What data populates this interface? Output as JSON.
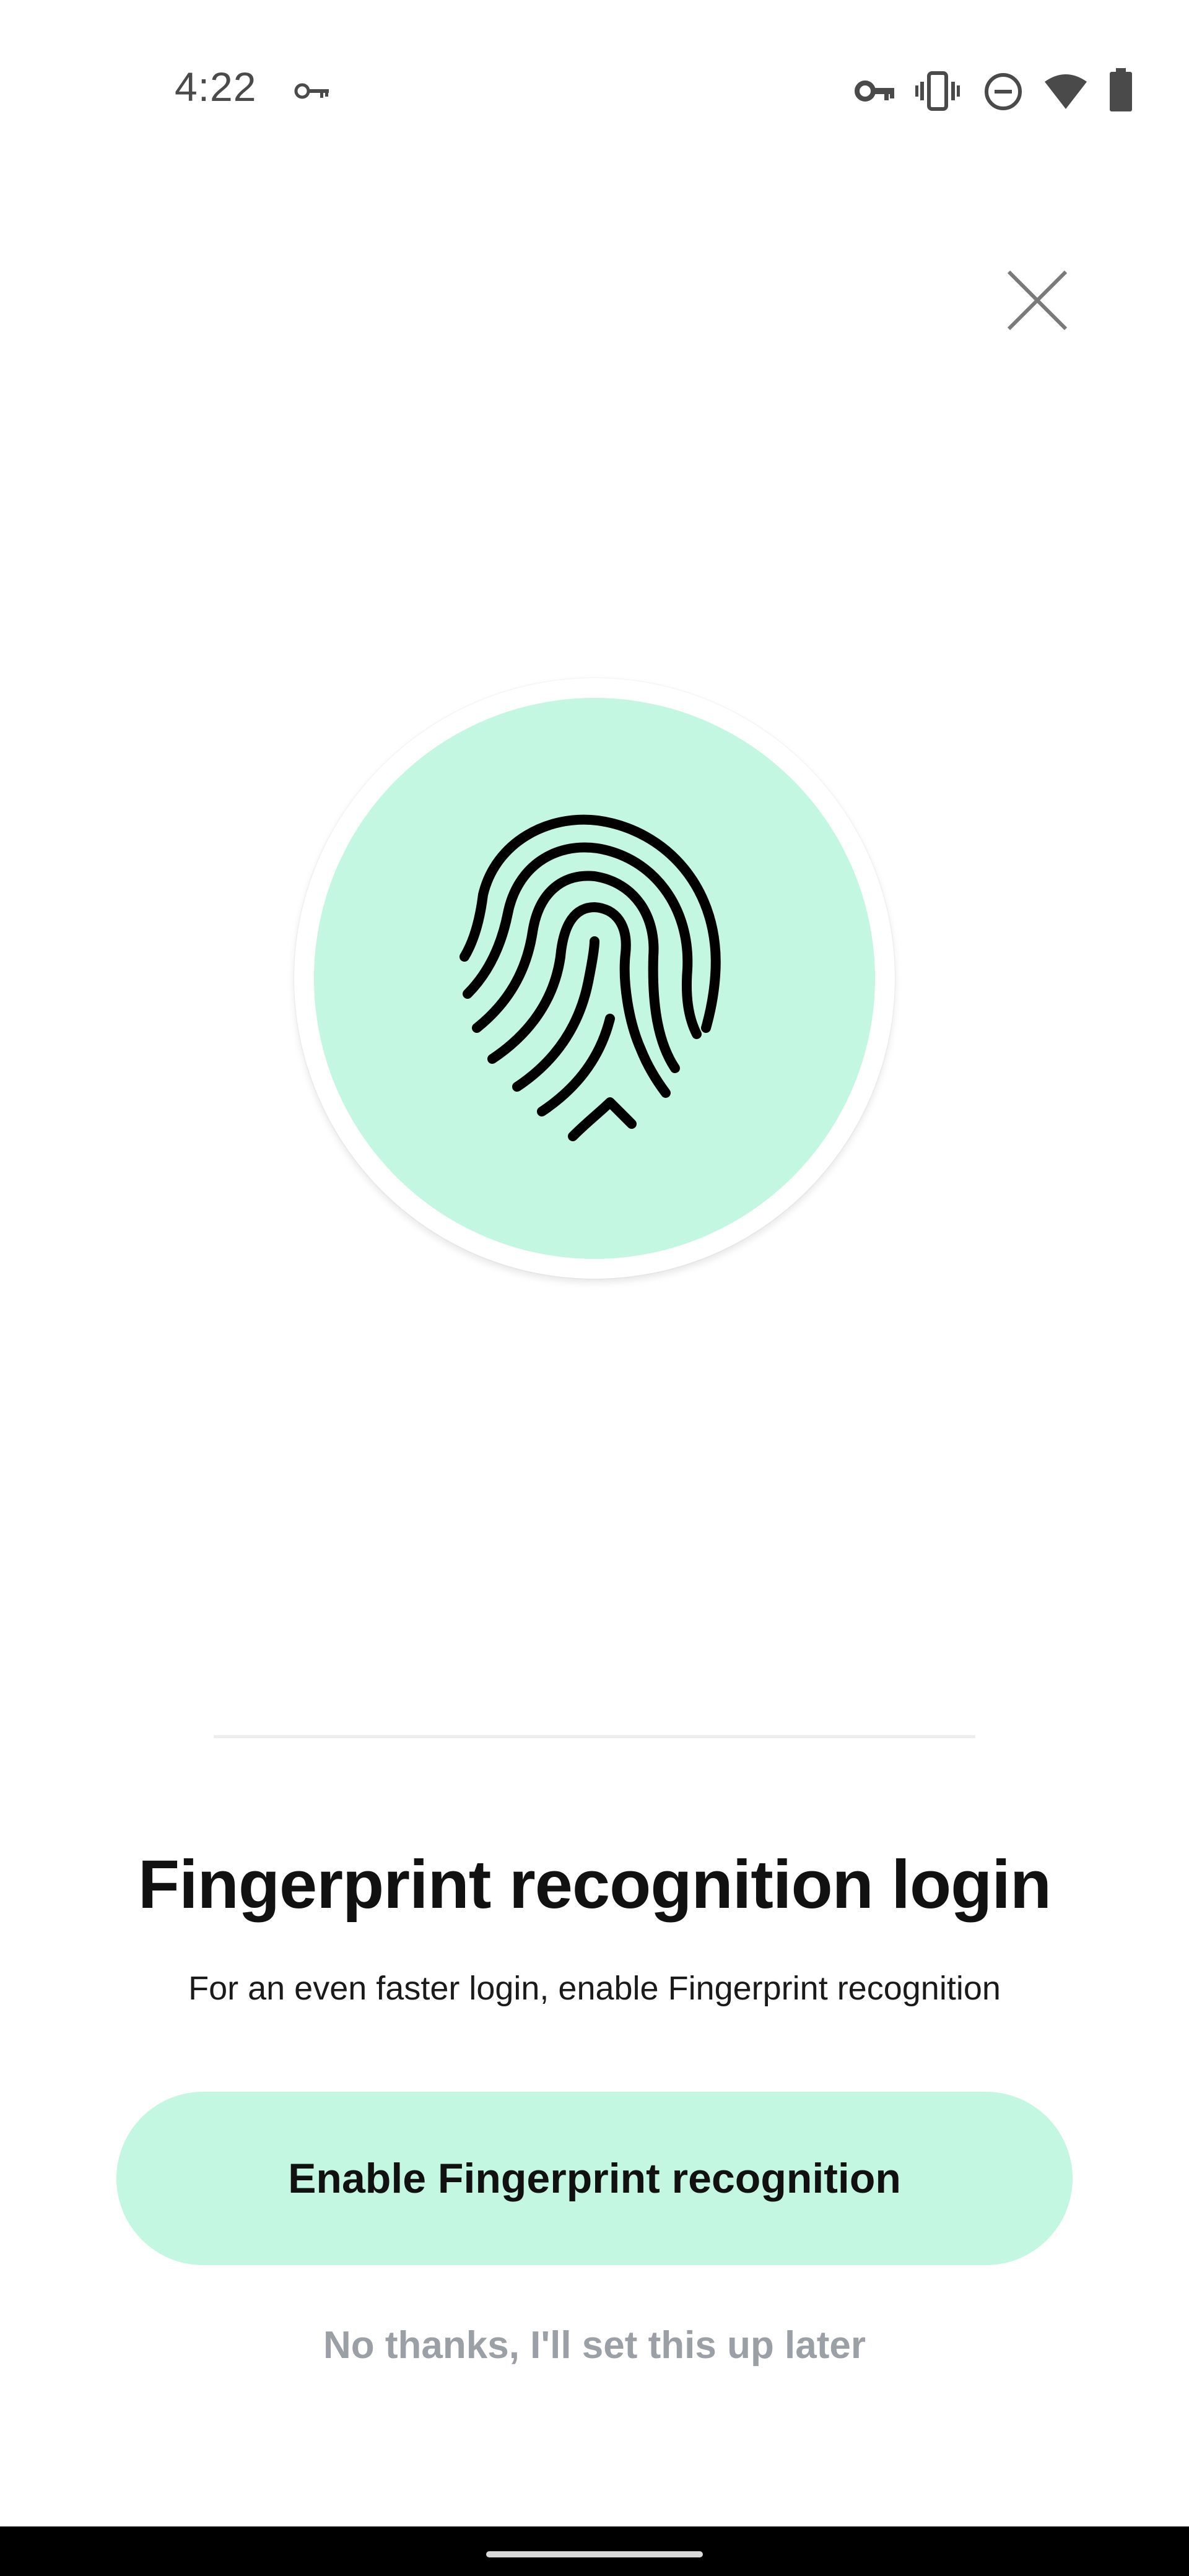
{
  "status_bar": {
    "time": "4:22",
    "icons": [
      "vpn-key-icon",
      "vpn-key-icon",
      "vibrate-icon",
      "do-not-disturb-icon",
      "wifi-icon",
      "battery-icon"
    ]
  },
  "colors": {
    "accent": "#c3f7e2",
    "text_primary": "#111111",
    "text_muted": "#9aa0a6"
  },
  "hero": {
    "icon": "fingerprint-icon"
  },
  "content": {
    "title": "Fingerprint recognition login",
    "subtitle": "For an even faster login, enable Fingerprint recognition",
    "primary_button": "Enable Fingerprint recognition",
    "secondary_link": "No thanks, I'll set this up later"
  }
}
